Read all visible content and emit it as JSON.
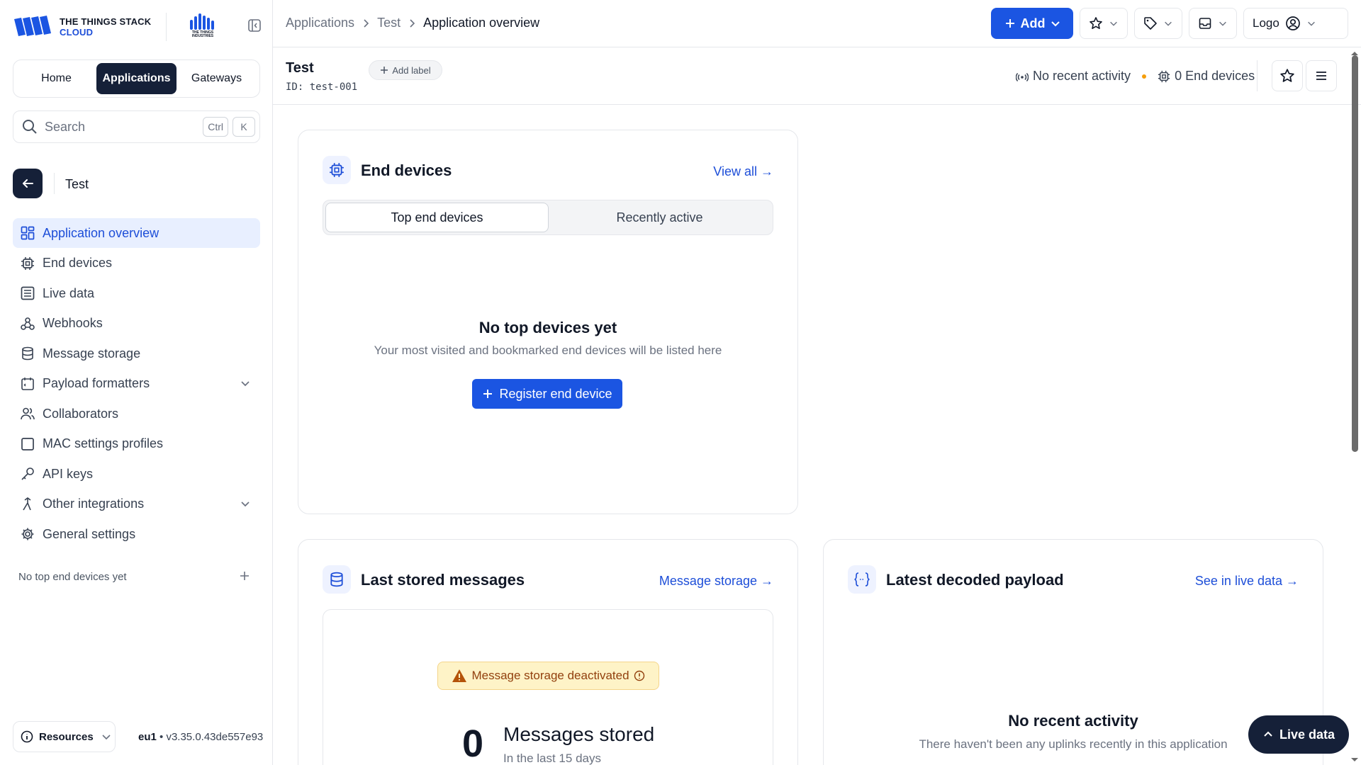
{
  "brand": {
    "line1": "THE THINGS STACK",
    "line2": "CLOUD",
    "tti": "THE THINGS INDUSTRIES"
  },
  "sidebar": {
    "tabs": [
      {
        "label": "Home"
      },
      {
        "label": "Applications"
      },
      {
        "label": "Gateways"
      }
    ],
    "search": {
      "placeholder": "Search",
      "kbd1": "Ctrl",
      "kbd2": "K"
    },
    "app_name": "Test",
    "items": [
      {
        "label": "Application overview",
        "icon": "dashboard-icon"
      },
      {
        "label": "End devices",
        "icon": "chip-icon"
      },
      {
        "label": "Live data",
        "icon": "list-icon"
      },
      {
        "label": "Webhooks",
        "icon": "webhook-icon"
      },
      {
        "label": "Message storage",
        "icon": "database-icon"
      },
      {
        "label": "Payload formatters",
        "icon": "code-icon"
      },
      {
        "label": "Collaborators",
        "icon": "users-icon"
      },
      {
        "label": "MAC settings profiles",
        "icon": "square-icon"
      },
      {
        "label": "API keys",
        "icon": "key-icon"
      },
      {
        "label": "Other integrations",
        "icon": "integration-icon"
      },
      {
        "label": "General settings",
        "icon": "gear-icon"
      }
    ],
    "no_top_devices": "No top end devices yet",
    "resources": "Resources",
    "region": "eu1",
    "version": "v3.35.0.43de557e93"
  },
  "topbar": {
    "breadcrumbs": [
      "Applications",
      "Test",
      "Application overview"
    ],
    "add_label": "Add",
    "logo_alt": "Logo"
  },
  "header": {
    "title": "Test",
    "id": "ID: test-001",
    "add_label": "Add label",
    "activity": "No recent activity",
    "end_devices": "0 End devices"
  },
  "end_devices_card": {
    "title": "End devices",
    "link": "View all →",
    "tabs": [
      "Top end devices",
      "Recently active"
    ],
    "empty_title": "No top devices yet",
    "empty_sub": "Your most visited and bookmarked end devices will be listed here",
    "register": "Register end device"
  },
  "stored_card": {
    "title": "Last stored messages",
    "link": "Message storage →",
    "warning": "Message storage deactivated",
    "count": "0",
    "count_label": "Messages stored",
    "period": "In the last 15 days"
  },
  "payload_card": {
    "title": "Latest decoded payload",
    "link": "See in live data →",
    "empty_title": "No recent activity",
    "empty_sub": "There haven't been any uplinks recently in this application"
  },
  "live_data": "Live data",
  "colors": {
    "primary": "#1b55e2",
    "dark": "#152038",
    "warning_bg": "#fef3c7",
    "warning_text": "#92400e"
  }
}
